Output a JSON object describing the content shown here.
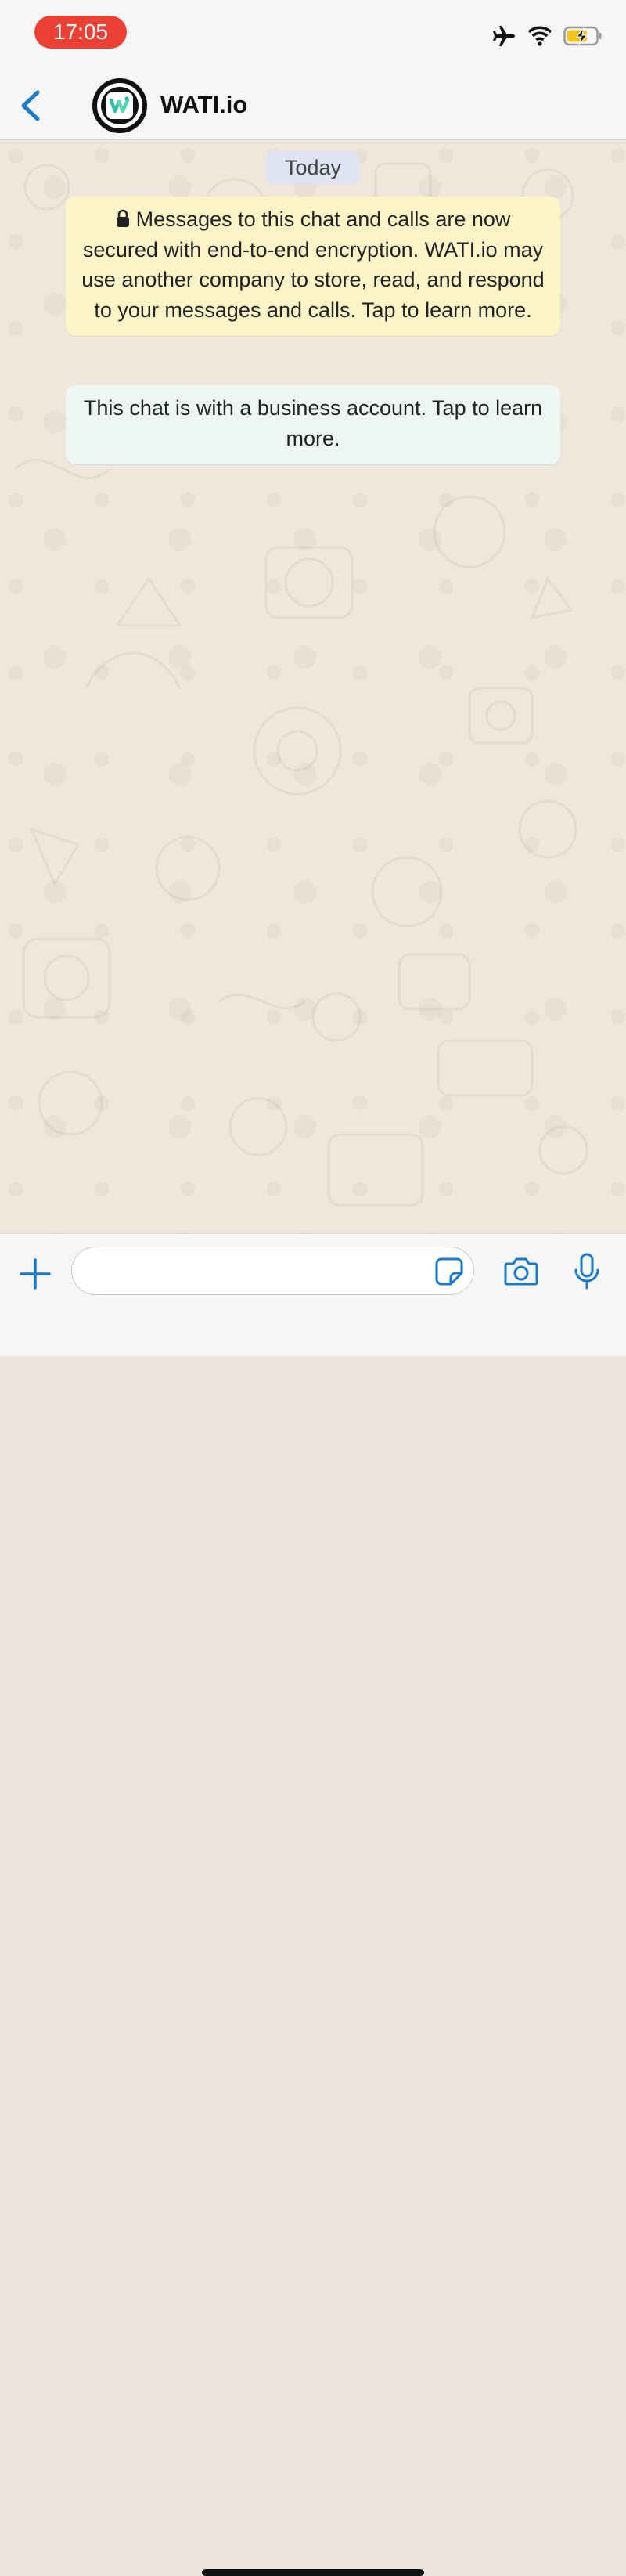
{
  "status_bar": {
    "time": "17:05",
    "icons": [
      "airplane-icon",
      "wifi-icon",
      "battery-charging-icon"
    ],
    "time_pill_color": "#eb4034"
  },
  "header": {
    "back_icon": "chevron-left-icon",
    "title": "WATI.io",
    "accent": "#1a7acb"
  },
  "chat": {
    "date_label": "Today",
    "encryption_notice": "Messages to this chat and calls are now secured with end-to-end encryption. WATI.io may use another company to store, read, and respond to your messages and calls. Tap to learn more.",
    "business_notice": "This chat is with a business account. Tap to learn more."
  },
  "composer": {
    "input_value": "",
    "input_placeholder": "",
    "icons": [
      "plus-icon",
      "sticker-icon",
      "camera-icon",
      "microphone-icon"
    ]
  }
}
